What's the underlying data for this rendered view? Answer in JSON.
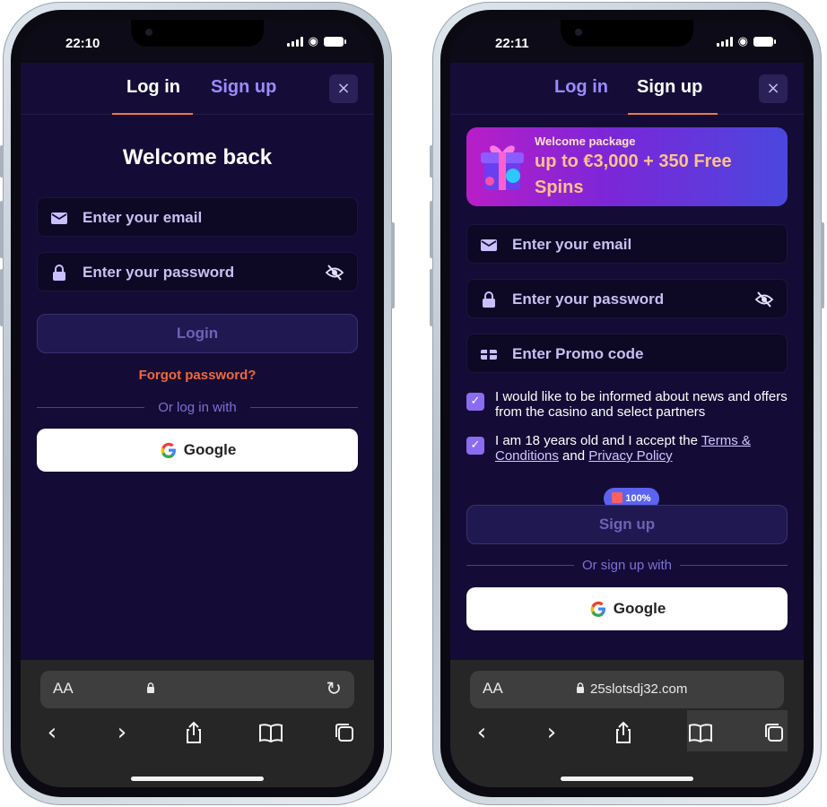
{
  "left_screen": {
    "status_time": "22:10",
    "tabs": {
      "login": "Log in",
      "signup": "Sign up"
    },
    "close": "×",
    "title": "Welcome back",
    "email_placeholder": "Enter your email",
    "password_placeholder": "Enter your password",
    "login_button": "Login",
    "forgot": "Forgot password?",
    "divider": "Or log in with",
    "google": "Google",
    "browser": {
      "aa": "AA",
      "url": ""
    }
  },
  "right_screen": {
    "status_time": "22:11",
    "tabs": {
      "login": "Log in",
      "signup": "Sign up"
    },
    "close": "×",
    "banner": {
      "subtitle": "Welcome package",
      "headline": "up to €3,000 + 350 Free Spins"
    },
    "email_placeholder": "Enter your email",
    "password_placeholder": "Enter your password",
    "promo_placeholder": "Enter Promo code",
    "consent_news": "I would like to be informed about news and offers from the casino and select partners",
    "consent_terms_prefix": "I am 18 years old and I accept the ",
    "terms_link": "Terms & Conditions",
    "consent_and": " and ",
    "privacy_link": "Privacy Policy",
    "promo_badge": "100%",
    "signup_button": "Sign up",
    "divider": "Or sign up with",
    "google": "Google",
    "browser": {
      "aa": "AA",
      "url": "25slotsdj32.com"
    }
  },
  "colors": {
    "background": "#140c36",
    "accent_orange": "#f07a3c",
    "accent_purple": "#9b8cff",
    "checkbox": "#8b6cf0"
  },
  "icons": [
    "mail-icon",
    "lock-icon",
    "eye-off-icon",
    "gift-icon",
    "google-icon",
    "back-icon",
    "forward-icon",
    "share-icon",
    "bookmarks-icon",
    "tabs-icon",
    "reload-icon"
  ]
}
